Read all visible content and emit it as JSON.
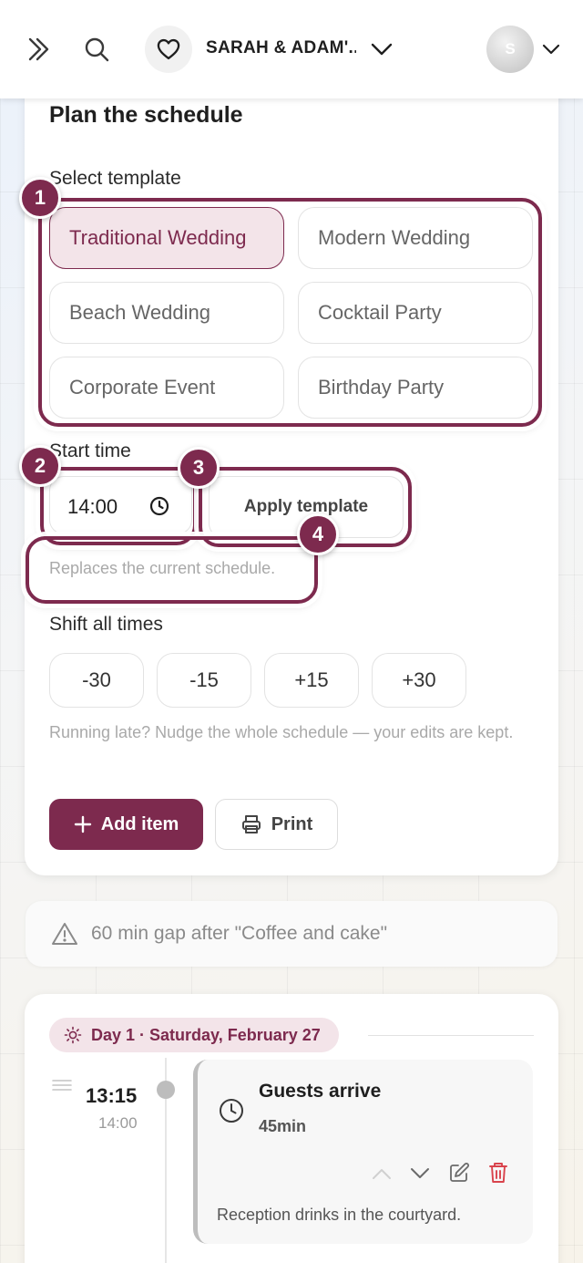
{
  "header": {
    "event_name": "SARAH & ADAM'...",
    "avatar_initial": "S"
  },
  "plan": {
    "title": "Plan the schedule",
    "template_label": "Select template",
    "templates": [
      "Traditional Wedding",
      "Modern Wedding",
      "Beach Wedding",
      "Cocktail Party",
      "Corporate Event",
      "Birthday Party"
    ],
    "selected_template": "Traditional Wedding",
    "start_time_label": "Start time",
    "start_time": "14:00",
    "apply_label": "Apply template",
    "apply_hint": "Replaces the current schedule.",
    "shift_label": "Shift all times",
    "shift_options": [
      "-30",
      "-15",
      "+15",
      "+30"
    ],
    "shift_hint": "Running late? Nudge the whole schedule — your edits are kept.",
    "add_label": "Add item",
    "print_label": "Print"
  },
  "annotations": [
    "1",
    "2",
    "3",
    "4"
  ],
  "warning": {
    "text": "60 min gap after \"Coffee and cake\""
  },
  "schedule": {
    "day_label": "Day 1 · Saturday, February 27",
    "item": {
      "time": "13:15",
      "end_time": "14:00",
      "title": "Guests arrive",
      "duration": "45min",
      "note": "Reception drinks in the courtyard."
    }
  },
  "colors": {
    "accent": "#7d2a4e",
    "accent_soft": "#f3e4e9",
    "delete": "#d9434c"
  },
  "icons": [
    "chevrons-right-icon",
    "search-icon",
    "heart-icon",
    "chevron-down-icon",
    "clock-icon",
    "plus-icon",
    "printer-icon",
    "warning-icon",
    "sun-icon",
    "drag-handle-icon",
    "chevron-up-icon",
    "edit-icon",
    "trash-icon"
  ]
}
